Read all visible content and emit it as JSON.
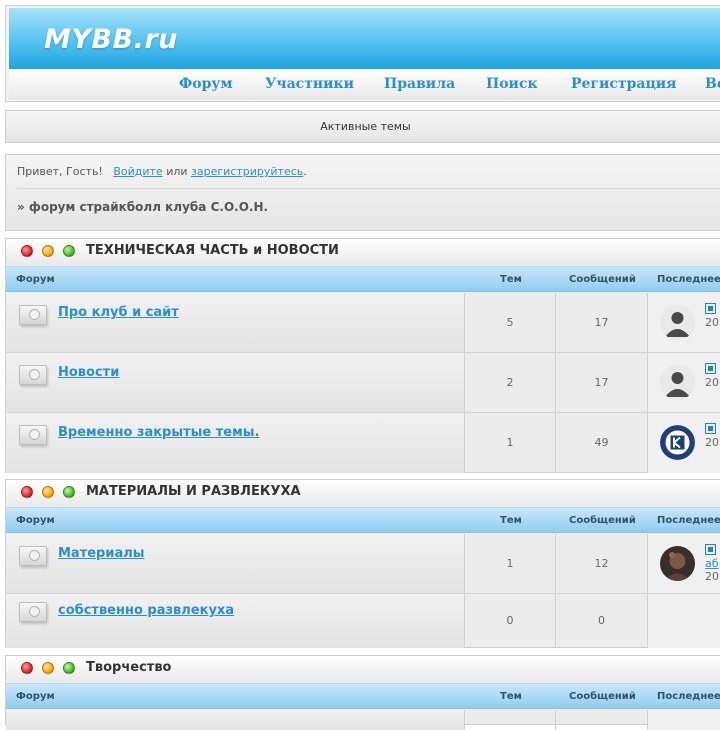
{
  "header": {
    "logo": "MYBB.ru"
  },
  "nav": [
    "Форум",
    "Участники",
    "Правила",
    "Поиск",
    "Регистрация",
    "Во"
  ],
  "active_topics": "Активные темы",
  "welcome": {
    "greeting": "Привет, Гость!",
    "login": "Войдите",
    "or": "или",
    "register": "зарегистрируйтесь",
    "period": ".",
    "breadcrumb": "» форум страйкболл клуба С.О.О.Н."
  },
  "columns": {
    "forum": "Форум",
    "topics": "Тем",
    "posts": "Сообщений",
    "last": "Последнее"
  },
  "categories": [
    {
      "title": "ТЕХНИЧЕСКАЯ ЧАСТЬ и НОВОСТИ",
      "forums": [
        {
          "name": "Про клуб и сайт",
          "topics": "5",
          "posts": "17",
          "last_date": "20",
          "last_user": "",
          "avatar": "silhouette-avatar"
        },
        {
          "name": "Новости",
          "topics": "2",
          "posts": "17",
          "last_date": "20",
          "last_user": "",
          "avatar": "silhouette-avatar"
        },
        {
          "name": "Временно закрытые темы.",
          "topics": "1",
          "posts": "49",
          "last_date": "20",
          "last_user": "",
          "avatar": "club-logo-avatar"
        }
      ]
    },
    {
      "title": "МАТЕРИАЛЫ И РАЗВЛЕКУХА",
      "forums": [
        {
          "name": "Материалы",
          "topics": "1",
          "posts": "12",
          "last_date": "20",
          "last_user": "аб",
          "avatar": "photo-avatar"
        },
        {
          "name": "собственно развлекуха",
          "topics": "0",
          "posts": "0",
          "last_date": "",
          "last_user": "",
          "avatar": ""
        }
      ]
    },
    {
      "title": "Творчество",
      "forums": []
    }
  ],
  "colors": {
    "accent": "#2a8fd0",
    "banner": "#1ea3e0",
    "column_header": "#8fcdf2"
  }
}
